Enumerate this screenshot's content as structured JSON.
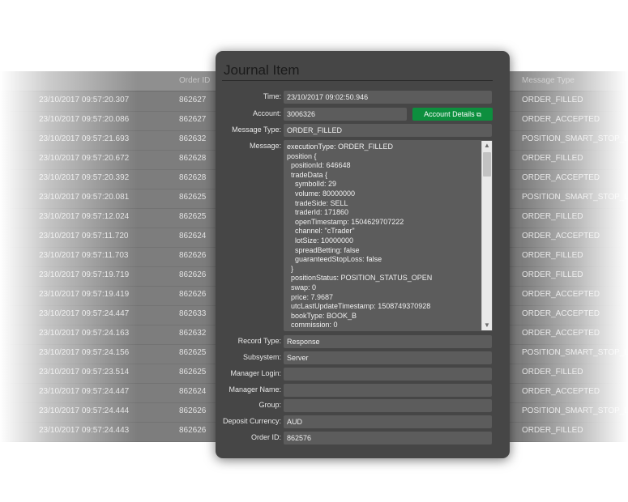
{
  "background_table": {
    "headers": {
      "order_id": "Order ID",
      "message_type": "Message Type"
    },
    "rows": [
      {
        "time": "23/10/2017 09:57:20.307",
        "order_id": "862627",
        "message_type": "ORDER_FILLED"
      },
      {
        "time": "23/10/2017 09:57:20.086",
        "order_id": "862627",
        "message_type": "ORDER_ACCEPTED"
      },
      {
        "time": "23/10/2017 09:57:21.693",
        "order_id": "862632",
        "message_type": "POSITION_SMART_STOP_LOSS"
      },
      {
        "time": "23/10/2017 09:57:20.672",
        "order_id": "862628",
        "message_type": "ORDER_FILLED"
      },
      {
        "time": "23/10/2017 09:57:20.392",
        "order_id": "862628",
        "message_type": "ORDER_ACCEPTED"
      },
      {
        "time": "23/10/2017 09:57:20.081",
        "order_id": "862625",
        "message_type": "POSITION_SMART_STOP_LOSS"
      },
      {
        "time": "23/10/2017 09:57:12.024",
        "order_id": "862625",
        "message_type": "ORDER_FILLED"
      },
      {
        "time": "23/10/2017 09:57:11.720",
        "order_id": "862624",
        "message_type": "ORDER_ACCEPTED"
      },
      {
        "time": "23/10/2017 09:57:11.703",
        "order_id": "862626",
        "message_type": "ORDER_FILLED"
      },
      {
        "time": "23/10/2017 09:57:19.719",
        "order_id": "862626",
        "message_type": "ORDER_FILLED"
      },
      {
        "time": "23/10/2017 09:57:19.419",
        "order_id": "862626",
        "message_type": "ORDER_ACCEPTED"
      },
      {
        "time": "23/10/2017 09:57:24.447",
        "order_id": "862633",
        "message_type": "ORDER_ACCEPTED"
      },
      {
        "time": "23/10/2017 09:57:24.163",
        "order_id": "862632",
        "message_type": "ORDER_ACCEPTED"
      },
      {
        "time": "23/10/2017 09:57:24.156",
        "order_id": "862625",
        "message_type": "POSITION_SMART_STOP_LOSS"
      },
      {
        "time": "23/10/2017 09:57:23.514",
        "order_id": "862625",
        "message_type": "ORDER_FILLED"
      },
      {
        "time": "23/10/2017 09:57:24.447",
        "order_id": "862624",
        "message_type": "ORDER_ACCEPTED"
      },
      {
        "time": "23/10/2017 09:57:24.444",
        "order_id": "862626",
        "message_type": "POSITION_SMART_STOP_LOSS"
      },
      {
        "time": "23/10/2017 09:57:24.443",
        "order_id": "862626",
        "message_type": "ORDER_FILLED"
      }
    ]
  },
  "dialog": {
    "title": "Journal Item",
    "fields": {
      "time": {
        "label": "Time:",
        "value": "23/10/2017 09:02:50.946"
      },
      "account": {
        "label": "Account:",
        "value": "3006326"
      },
      "message_type": {
        "label": "Message Type:",
        "value": "ORDER_FILLED"
      },
      "message": {
        "label": "Message:"
      },
      "record_type": {
        "label": "Record Type:",
        "value": "Response"
      },
      "subsystem": {
        "label": "Subsystem:",
        "value": "Server"
      },
      "manager_login": {
        "label": "Manager Login:",
        "value": ""
      },
      "manager_name": {
        "label": "Manager Name:",
        "value": ""
      },
      "group": {
        "label": "Group:",
        "value": ""
      },
      "deposit_currency": {
        "label": "Deposit Currency:",
        "value": "AUD"
      },
      "order_id": {
        "label": "Order ID:",
        "value": "862576"
      }
    },
    "account_details_button": {
      "label": "Account Details",
      "icon": "external-link-icon"
    },
    "message_lines": [
      "executionType: ORDER_FILLED",
      "position {",
      "  positionId: 646648",
      "  tradeData {",
      "    symbolId: 29",
      "    volume: 80000000",
      "    tradeSide: SELL",
      "    traderId: 171860",
      "    openTimestamp: 1504629707222",
      "    channel: \"cTrader\"",
      "    lotSize: 10000000",
      "    spreadBetting: false",
      "    guaranteedStopLoss: false",
      "  }",
      "  positionStatus: POSITION_STATUS_OPEN",
      "  swap: 0",
      "  price: 7.9687",
      "  utcLastUpdateTimestamp: 1508749370928",
      "  bookType: BOOK_B",
      "  commission: 0"
    ]
  }
}
